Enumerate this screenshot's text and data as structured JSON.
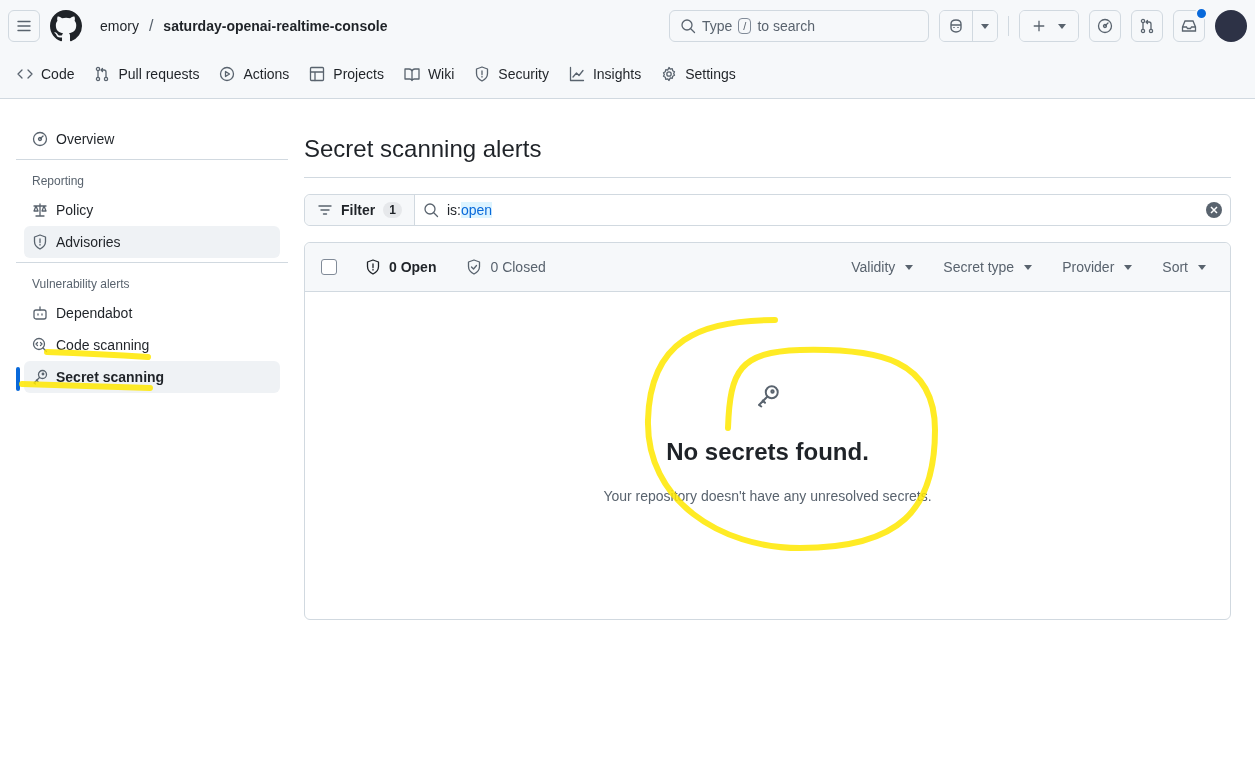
{
  "header": {
    "owner": "emory",
    "separator": "/",
    "repo": "saturday-openai-realtime-console",
    "search": {
      "placeholder_before": "Type",
      "key": "/",
      "placeholder_after": "to search"
    },
    "notification_unread": true
  },
  "repo_nav": [
    {
      "label": "Code",
      "selected": false
    },
    {
      "label": "Pull requests",
      "selected": false
    },
    {
      "label": "Actions",
      "selected": false
    },
    {
      "label": "Projects",
      "selected": false
    },
    {
      "label": "Wiki",
      "selected": false
    },
    {
      "label": "Security",
      "selected": false
    },
    {
      "label": "Insights",
      "selected": false
    },
    {
      "label": "Settings",
      "selected": false
    }
  ],
  "sidebar": {
    "groups": [
      {
        "items": [
          {
            "label": "Overview",
            "selected": false,
            "hovered": false
          }
        ]
      },
      {
        "heading": "Reporting",
        "items": [
          {
            "label": "Policy",
            "selected": false,
            "hovered": false
          },
          {
            "label": "Advisories",
            "selected": false,
            "hovered": true
          }
        ]
      },
      {
        "heading": "Vulnerability alerts",
        "items": [
          {
            "label": "Dependabot",
            "selected": false,
            "hovered": false
          },
          {
            "label": "Code scanning",
            "selected": false,
            "hovered": false
          },
          {
            "label": "Secret scanning",
            "selected": true,
            "hovered": false
          }
        ]
      }
    ]
  },
  "page_title": "Secret scanning alerts",
  "filter": {
    "label": "Filter",
    "count": "1",
    "query_key": "is:",
    "query_value": "open"
  },
  "alerts": {
    "select_all_checked": false,
    "states": [
      {
        "label": "0 Open",
        "selected": true
      },
      {
        "label": "0 Closed",
        "selected": false
      }
    ],
    "menus": [
      "Validity",
      "Secret type",
      "Provider",
      "Sort"
    ],
    "empty": {
      "title": "No secrets found.",
      "description": "Your repository doesn't have any unresolved secrets."
    }
  }
}
